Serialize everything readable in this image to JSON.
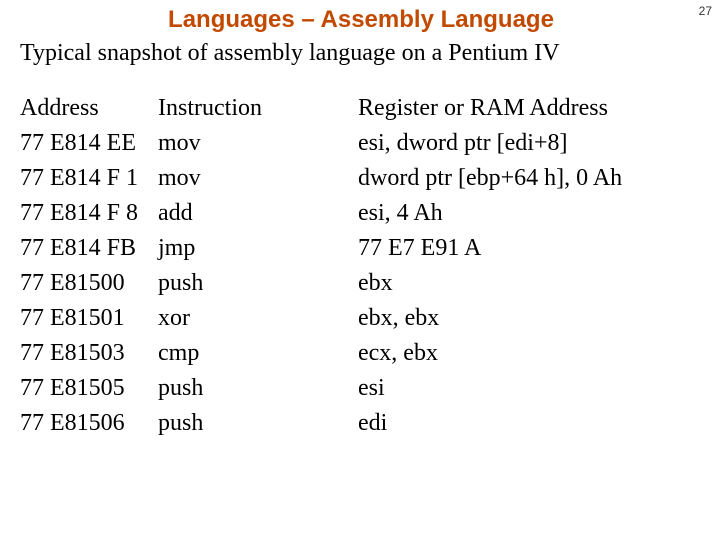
{
  "page_number": "27",
  "title": "Languages – Assembly Language",
  "subtitle": "Typical snapshot of assembly language on a Pentium IV",
  "headers": {
    "address": "Address",
    "instruction": "Instruction",
    "operand": "Register or RAM Address"
  },
  "rows": [
    {
      "address": "77 E814 EE",
      "instruction": "mov",
      "operand": "esi, dword ptr [edi+8]"
    },
    {
      "address": "77 E814 F 1",
      "instruction": "mov",
      "operand": "dword ptr [ebp+64 h], 0 Ah"
    },
    {
      "address": "77 E814 F 8",
      "instruction": "add",
      "operand": "esi, 4 Ah"
    },
    {
      "address": "77 E814 FB",
      "instruction": "jmp",
      "operand": "77 E7 E91 A"
    },
    {
      "address": "77 E81500",
      "instruction": "push",
      "operand": "ebx"
    },
    {
      "address": "77 E81501",
      "instruction": "xor",
      "operand": "ebx, ebx"
    },
    {
      "address": "77 E81503",
      "instruction": "cmp",
      "operand": "ecx, ebx"
    },
    {
      "address": "77 E81505",
      "instruction": "push",
      "operand": "esi"
    },
    {
      "address": "77 E81506",
      "instruction": "push",
      "operand": "edi"
    }
  ]
}
